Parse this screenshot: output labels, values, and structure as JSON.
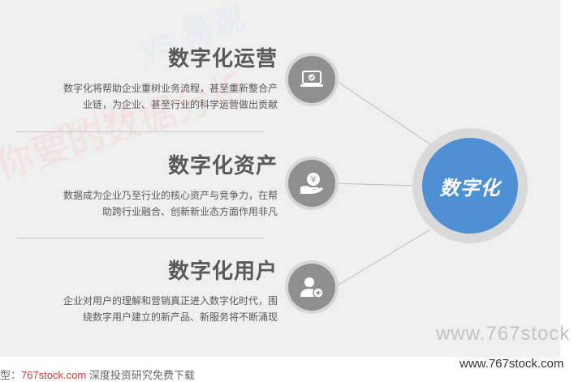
{
  "center": {
    "label": "数字化",
    "color": "#4f8fd4"
  },
  "sections": [
    {
      "title": "数字化运营",
      "desc_line1": "数字化将帮助企业重树业务流程，甚至重新整合产",
      "desc_line2": "业链，为企业、甚至行业的科学运营做出贡献",
      "icon": "laptop-check-icon"
    },
    {
      "title": "数字化资产",
      "desc_line1": "数据成为企业乃至行业的核心资产与竞争力，在帮",
      "desc_line2": "助跨行业融合、创新新业态方面作用非凡",
      "icon": "yuan-hand-icon"
    },
    {
      "title": "数字化用户",
      "desc_line1": "企业对用户的理解和营销真正进入数字化时代，围",
      "desc_line2": "绕数字用户建立的新产品、新服务将不断涌现",
      "icon": "user-add-icon"
    }
  ],
  "watermarks": {
    "wm1": "你要的数据分析",
    "wm2": "ys 易观",
    "wm3": "nalys"
  },
  "urls": {
    "large": "www.767stock",
    "small": "www.767stock.com"
  },
  "footer": {
    "prefix": "型：",
    "link": "767stock.com",
    "text": "深度投资研究免费下载"
  }
}
